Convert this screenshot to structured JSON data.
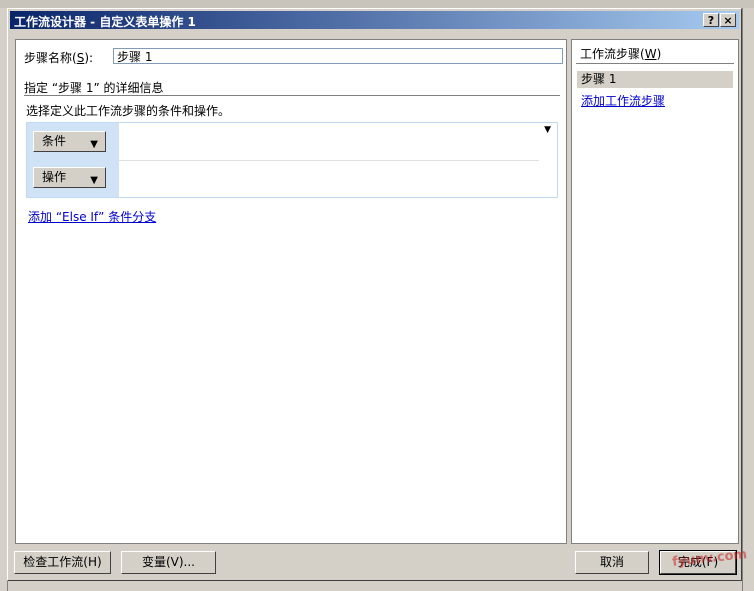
{
  "dialog": {
    "title": "工作流设计器 - 自定义表单操作 1",
    "help_button": "?",
    "close_button": "×"
  },
  "step_name": {
    "label": "步骤名称(",
    "hotkey": "S",
    "label_end": "):",
    "value": "步骤 1"
  },
  "details": {
    "heading": "指定 “步骤 1” 的详细信息",
    "instruction": "选择定义此工作流步骤的条件和操作。",
    "conditions_button": "条件",
    "actions_button": "操作",
    "add_else_if_link": "添加 “Else If” 条件分支"
  },
  "steps_panel": {
    "title": "工作流步骤(",
    "hotkey": "W",
    "title_end": ")",
    "items": [
      "步骤 1"
    ],
    "add_step_link": "添加工作流步骤"
  },
  "footer": {
    "check_workflow": "检查工作流(H)",
    "variables": "变量(V)...",
    "cancel": "取消",
    "finish": "完成(F)"
  },
  "watermark": "fyunv.com",
  "colors": {
    "title_start": "#0a246a",
    "title_end": "#a6caf0",
    "link": "#0000cc",
    "condition_side": "#cfe2f6"
  }
}
